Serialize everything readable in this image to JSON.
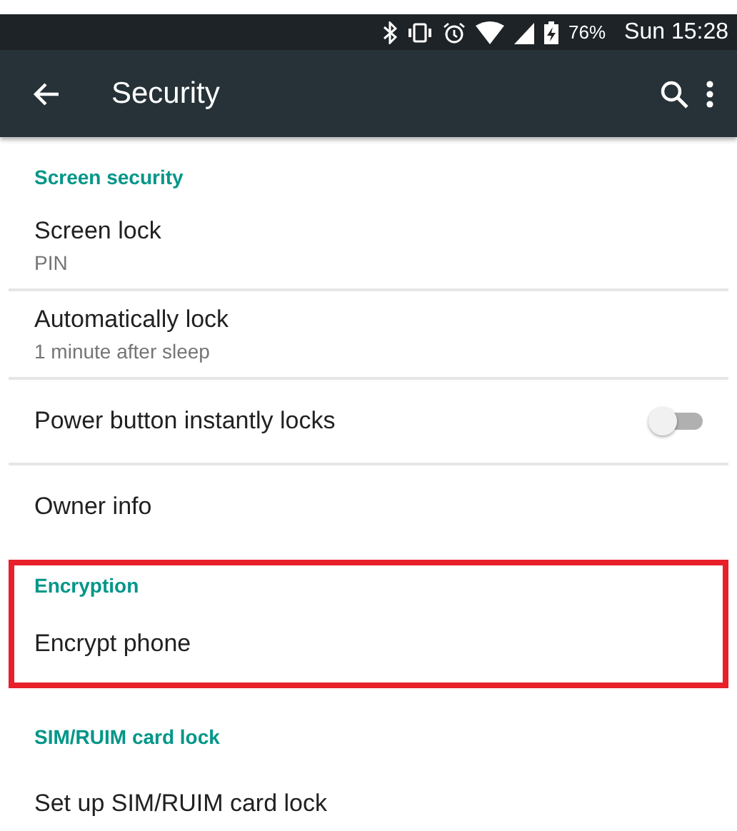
{
  "status_bar": {
    "battery": "76%",
    "time": "Sun 15:28"
  },
  "toolbar": {
    "title": "Security"
  },
  "sections": [
    {
      "header": "Screen security",
      "highlighted": false,
      "items": [
        {
          "kind": "text",
          "title": "Screen lock",
          "summary": "PIN"
        },
        {
          "kind": "text",
          "title": "Automatically lock",
          "summary": "1 minute after sleep"
        },
        {
          "kind": "toggle",
          "title": "Power button instantly locks",
          "on": false
        },
        {
          "kind": "text",
          "title": "Owner info"
        }
      ]
    },
    {
      "header": "Encryption",
      "highlighted": true,
      "items": [
        {
          "kind": "text",
          "title": "Encrypt phone"
        }
      ]
    },
    {
      "header": "SIM/RUIM card lock",
      "highlighted": false,
      "items": [
        {
          "kind": "text",
          "title": "Set up SIM/RUIM card lock"
        }
      ]
    }
  ]
}
